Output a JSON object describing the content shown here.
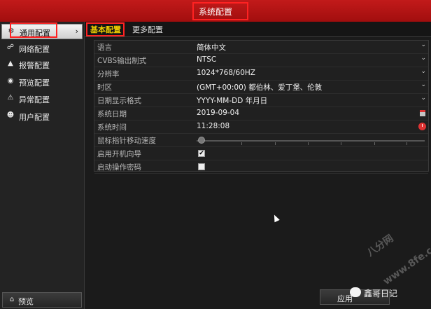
{
  "window": {
    "title": "系统配置"
  },
  "sidebar": {
    "items": [
      {
        "label": "通用配置",
        "icon": "gear-icon",
        "active": true
      },
      {
        "label": "网络配置",
        "icon": "network-icon"
      },
      {
        "label": "报警配置",
        "icon": "alarm-icon"
      },
      {
        "label": "预览配置",
        "icon": "eye-icon"
      },
      {
        "label": "异常配置",
        "icon": "warning-icon"
      },
      {
        "label": "用户配置",
        "icon": "users-icon"
      }
    ],
    "preview_label": "预览"
  },
  "tabs": [
    {
      "label": "基本配置",
      "active": true
    },
    {
      "label": "更多配置"
    }
  ],
  "settings": {
    "language": {
      "label": "语言",
      "value": "简体中文"
    },
    "cvbs": {
      "label": "CVBS输出制式",
      "value": "NTSC"
    },
    "resolution": {
      "label": "分辨率",
      "value": "1024*768/60HZ"
    },
    "timezone": {
      "label": "时区",
      "value": "(GMT+00:00) 都伯林、爱丁堡、伦敦"
    },
    "date_format": {
      "label": "日期显示格式",
      "value": "YYYY-MM-DD 年月日"
    },
    "system_date": {
      "label": "系统日期",
      "value": "2019-09-04"
    },
    "system_time": {
      "label": "系统时间",
      "value": "11:28:08"
    },
    "mouse_speed": {
      "label": "鼠标指针移动速度"
    },
    "startup_wizard": {
      "label": "启用开机向导",
      "checked": true
    },
    "enable_password": {
      "label": "启动操作密码",
      "checked": false
    }
  },
  "footer": {
    "apply_label": "应用"
  },
  "watermark": {
    "text": "鑫哥日记",
    "site": "八分网",
    "url": "www.8fe.com"
  },
  "colors": {
    "title_bar": "#b01414",
    "highlight": "#ff2222",
    "tab_active": "#f0d000"
  }
}
